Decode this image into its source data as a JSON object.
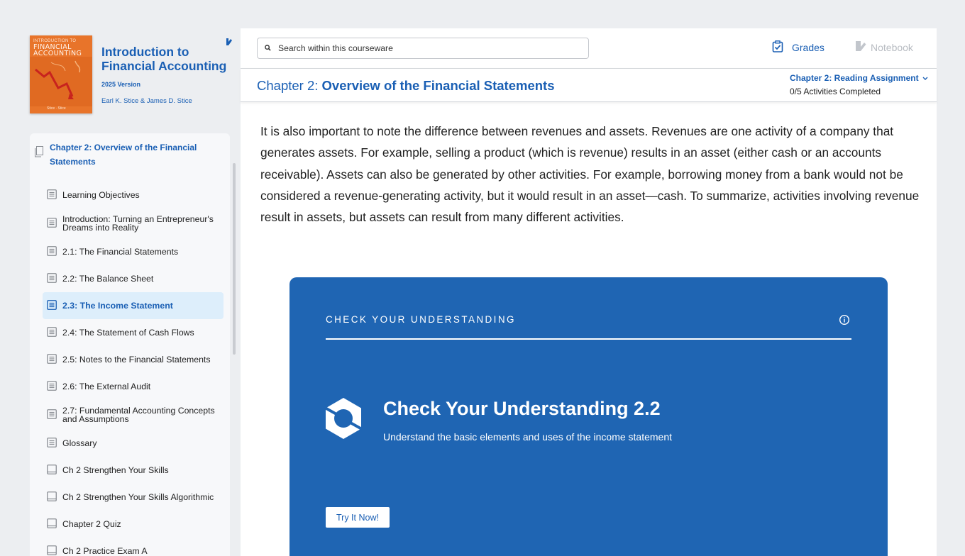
{
  "book": {
    "cover_line1": "INTRODUCTION TO",
    "cover_line2": "FINANCIAL\nACCOUNTING",
    "cover_authors": "Stice · Stice",
    "title": "Introduction to Financial Accounting",
    "version": "2025 Version",
    "authors": "Earl K. Stice & James D. Stice"
  },
  "toc": {
    "chapter_title": "Chapter 2: Overview of the Financial Statements",
    "items": [
      {
        "label": "Learning Objectives",
        "icon": "page-icon"
      },
      {
        "label": "Introduction: Turning an Entrepreneur's Dreams into Reality",
        "icon": "page-icon"
      },
      {
        "label": "2.1: The Financial Statements",
        "icon": "page-icon"
      },
      {
        "label": "2.2: The Balance Sheet",
        "icon": "page-icon"
      },
      {
        "label": "2.3: The Income Statement",
        "icon": "page-icon",
        "active": true
      },
      {
        "label": "2.4: The Statement of Cash Flows",
        "icon": "page-icon"
      },
      {
        "label": "2.5: Notes to the Financial Statements",
        "icon": "page-icon"
      },
      {
        "label": "2.6: The External Audit",
        "icon": "page-icon"
      },
      {
        "label": "2.7: Fundamental Accounting Concepts and Assumptions",
        "icon": "page-icon"
      },
      {
        "label": "Glossary",
        "icon": "page-icon"
      },
      {
        "label": "Ch 2 Strengthen Your Skills",
        "icon": "assignment-icon"
      },
      {
        "label": "Ch 2 Strengthen Your Skills Algorithmic",
        "icon": "assignment-icon"
      },
      {
        "label": "Chapter 2 Quiz",
        "icon": "assignment-icon"
      },
      {
        "label": "Ch 2 Practice Exam A",
        "icon": "assignment-icon"
      }
    ]
  },
  "header": {
    "search_placeholder": "Search within this courseware",
    "grades_label": "Grades",
    "notebook_label": "Notebook"
  },
  "chapter_bar": {
    "prefix": "Chapter 2: ",
    "title": "Overview of the Financial Statements",
    "assignment_label": "Chapter 2: Reading Assignment",
    "progress": "0/5 Activities Completed"
  },
  "content": {
    "paragraph": "It is also important to note the difference between revenues and assets. Revenues are one activity of a company that generates assets. For example, selling a product (which is revenue) results in an asset (either cash or an accounts receivable). Assets can also be generated by other activities. For example, borrowing money from a bank would not be considered a revenue-generating activity, but it would result in an asset—cash. To summarize, activities involving revenue result in assets, but assets can result from many different activities."
  },
  "check_card": {
    "label": "CHECK YOUR UNDERSTANDING",
    "title": "Check Your Understanding 2.2",
    "subtitle": "Understand the basic elements and uses of the income statement",
    "button": "Try It Now!"
  },
  "colors": {
    "accent": "#1a5fb4",
    "card_bg": "#1f65b3",
    "active_bg": "#ddeefb",
    "page_bg": "#eceef1"
  }
}
